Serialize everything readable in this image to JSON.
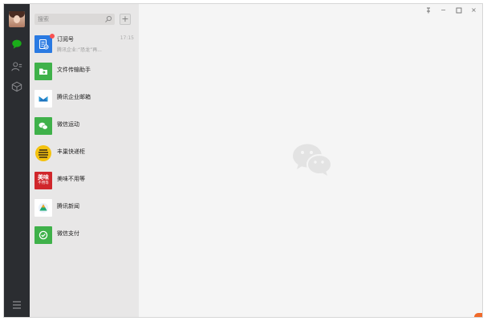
{
  "search": {
    "placeholder": "搜索"
  },
  "add_button": {
    "label": "+"
  },
  "chats": [
    {
      "name": "订阅号",
      "preview": "腾讯企业:“恐龙”再...",
      "time": "17:15",
      "badge": true,
      "icon": "subscription-icon",
      "color": "#2a7ae2"
    },
    {
      "name": "文件传输助手",
      "preview": "",
      "time": "",
      "badge": false,
      "icon": "folder-icon",
      "color": "#3fb14a"
    },
    {
      "name": "腾讯企业邮箱",
      "preview": "",
      "time": "",
      "badge": false,
      "icon": "mail-icon",
      "color": "#ffffff"
    },
    {
      "name": "微信运动",
      "preview": "",
      "time": "",
      "badge": false,
      "icon": "wechat-sport-icon",
      "color": "#3fb14a"
    },
    {
      "name": "丰巢快递柜",
      "preview": "",
      "time": "",
      "badge": false,
      "icon": "locker-icon",
      "color": "#f4c20f"
    },
    {
      "name": "美味不用等",
      "preview": "",
      "time": "",
      "badge": false,
      "icon": "restaurant-icon",
      "color": "#d0262b",
      "avatar_text_top": "美味",
      "avatar_text_bottom": "不用等"
    },
    {
      "name": "腾讯新闻",
      "preview": "",
      "time": "",
      "badge": false,
      "icon": "news-icon",
      "color": "#ffffff"
    },
    {
      "name": "微信支付",
      "preview": "",
      "time": "",
      "badge": false,
      "icon": "wechat-pay-icon",
      "color": "#3fb14a"
    }
  ],
  "rail": {
    "icons": [
      "chat-icon",
      "contacts-icon",
      "favorites-icon",
      "menu-icon"
    ],
    "active_color": "#1aad19"
  },
  "window_controls": {
    "pin": "⺪",
    "minimize": "−",
    "maximize": "□",
    "close": "×"
  },
  "colors": {
    "sidebar": "#2b2d31",
    "list_bg": "#e8e7e7",
    "main_bg": "#f5f5f5",
    "accent_green": "#1aad19"
  }
}
